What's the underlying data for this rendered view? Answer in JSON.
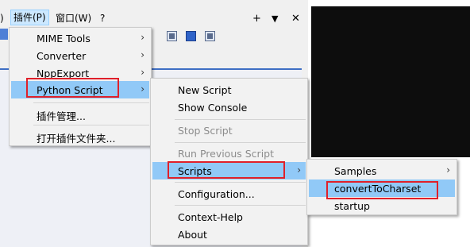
{
  "menubar": {
    "paren": ")",
    "plugins_label": "插件(P)",
    "window_label": "窗口(W)",
    "help_label": "?",
    "plus_label": "+",
    "dropdown_label": "▼",
    "close_label": "✕"
  },
  "plugins_menu": {
    "items": [
      {
        "label": "MIME Tools",
        "arrow": "›"
      },
      {
        "label": "Converter",
        "arrow": "›"
      },
      {
        "label": "NppExport",
        "arrow": "›"
      },
      {
        "label": "Python Script",
        "arrow": "›"
      },
      {
        "label": "插件管理..."
      },
      {
        "label": "打开插件文件夹..."
      }
    ]
  },
  "python_menu": {
    "items": [
      {
        "label": "New Script"
      },
      {
        "label": "Show Console"
      },
      {
        "label": "Stop Script",
        "disabled": true
      },
      {
        "label": "Run Previous Script",
        "disabled": true
      },
      {
        "label": "Scripts",
        "arrow": "›"
      },
      {
        "label": "Configuration..."
      },
      {
        "label": "Context-Help"
      },
      {
        "label": "About"
      }
    ]
  },
  "scripts_menu": {
    "items": [
      {
        "label": "Samples",
        "arrow": "›"
      },
      {
        "label": "convertToCharset"
      },
      {
        "label": "startup"
      }
    ]
  },
  "colors": {
    "highlight": "#91c9f7",
    "callout": "#e0202a",
    "menu_bg": "#f2f2f2"
  }
}
